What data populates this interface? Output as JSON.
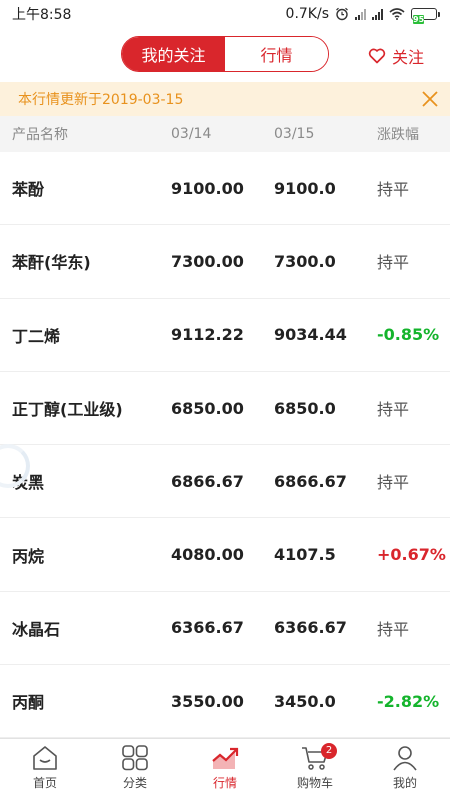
{
  "status_bar": {
    "time": "上午8:58",
    "net_speed": "0.7K/s",
    "battery": "95"
  },
  "header": {
    "tabs": [
      {
        "label": "我的关注",
        "active": true
      },
      {
        "label": "行情",
        "active": false
      }
    ],
    "follow_label": "关注"
  },
  "notice": {
    "text": "本行情更新于2019-03-15"
  },
  "table": {
    "columns": [
      "产品名称",
      "03/14",
      "03/15",
      "涨跌幅"
    ],
    "rows": [
      {
        "name": "苯酚",
        "prev": "9100.00",
        "curr": "9100.0",
        "change": "持平",
        "trend": "flat"
      },
      {
        "name": "苯酐(华东)",
        "prev": "7300.00",
        "curr": "7300.0",
        "change": "持平",
        "trend": "flat"
      },
      {
        "name": "丁二烯",
        "prev": "9112.22",
        "curr": "9034.44",
        "change": "-0.85%",
        "trend": "down"
      },
      {
        "name": "正丁醇(工业级)",
        "prev": "6850.00",
        "curr": "6850.0",
        "change": "持平",
        "trend": "flat"
      },
      {
        "name": "炭黑",
        "prev": "6866.67",
        "curr": "6866.67",
        "change": "持平",
        "trend": "flat"
      },
      {
        "name": "丙烷",
        "prev": "4080.00",
        "curr": "4107.5",
        "change": "+0.67%",
        "trend": "up"
      },
      {
        "name": "冰晶石",
        "prev": "6366.67",
        "curr": "6366.67",
        "change": "持平",
        "trend": "flat"
      },
      {
        "name": "丙酮",
        "prev": "3550.00",
        "curr": "3450.0",
        "change": "-2.82%",
        "trend": "down"
      }
    ]
  },
  "tabbar": {
    "items": [
      {
        "label": "首页",
        "icon": "home-icon"
      },
      {
        "label": "分类",
        "icon": "category-grid-icon"
      },
      {
        "label": "行情",
        "icon": "market-trend-icon",
        "active": true
      },
      {
        "label": "购物车",
        "icon": "cart-icon",
        "badge": "2"
      },
      {
        "label": "我的",
        "icon": "user-icon"
      }
    ]
  },
  "colors": {
    "brand_red": "#d9262c",
    "down_green": "#14b42c",
    "notice_orange": "#e8921e",
    "notice_bg": "#fdf1dc"
  }
}
